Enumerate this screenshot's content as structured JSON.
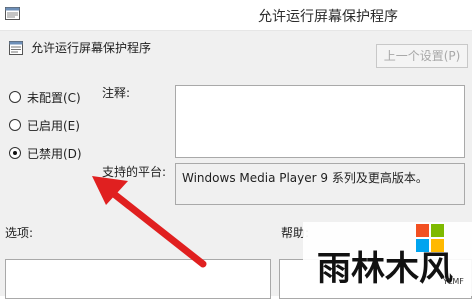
{
  "window": {
    "title": "允许运行屏幕保护程序"
  },
  "header": {
    "heading": "允许运行屏幕保护程序",
    "prev_setting_button": "上一个设置(P)"
  },
  "radios": [
    {
      "label": "未配置(C)",
      "checked": false
    },
    {
      "label": "已启用(E)",
      "checked": false
    },
    {
      "label": "已禁用(D)",
      "checked": true
    }
  ],
  "comment": {
    "label": "注释:",
    "value": ""
  },
  "supported": {
    "label": "支持的平台:",
    "value": "Windows Media Player 9 系列及更高版本。"
  },
  "options": {
    "label": "选项:"
  },
  "help": {
    "label": "帮助:"
  },
  "watermark": {
    "brand": "雨林木风",
    "sub": "YLMF"
  },
  "colors": {
    "arrow": "#e02020",
    "windows_logo": [
      "#f25022",
      "#7fba00",
      "#00a4ef",
      "#ffb900"
    ]
  }
}
